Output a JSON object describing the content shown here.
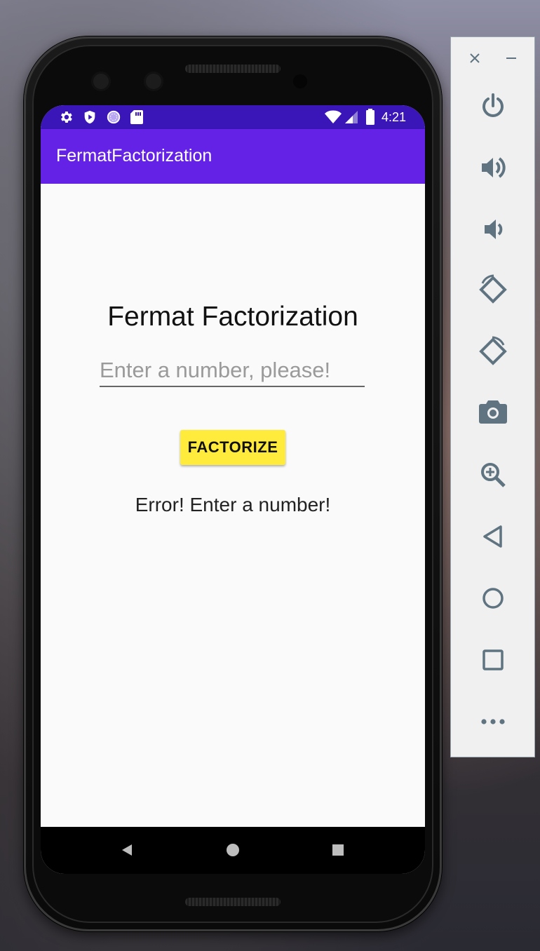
{
  "status_bar": {
    "time": "4:21",
    "left_icons": [
      "settings-icon",
      "shield-icon",
      "sync-icon",
      "sd-card-icon"
    ],
    "right_icons": [
      "wifi-icon",
      "signal-icon",
      "battery-icon"
    ]
  },
  "app_bar": {
    "title": "FermatFactorization"
  },
  "main": {
    "heading": "Fermat Factorization",
    "number_input": {
      "value": "",
      "placeholder": "Enter a number, please!"
    },
    "factorize_button": "FACTORIZE",
    "result_text": "Error! Enter a number!"
  },
  "nav_bar": {
    "buttons": [
      "back-icon",
      "home-icon",
      "recents-icon"
    ]
  },
  "emulator_panel": {
    "window_controls": [
      "close-icon",
      "minimize-icon"
    ],
    "controls": [
      "power-icon",
      "volume-up-icon",
      "volume-down-icon",
      "rotate-left-icon",
      "rotate-right-icon",
      "camera-icon",
      "zoom-icon",
      "back-icon",
      "home-icon",
      "overview-icon",
      "more-icon"
    ]
  },
  "colors": {
    "status_bar": "#3a16b8",
    "app_bar": "#6322e6",
    "button": "#ffeb3b",
    "background": "#fafafa",
    "panel_icon": "#5f7480"
  }
}
